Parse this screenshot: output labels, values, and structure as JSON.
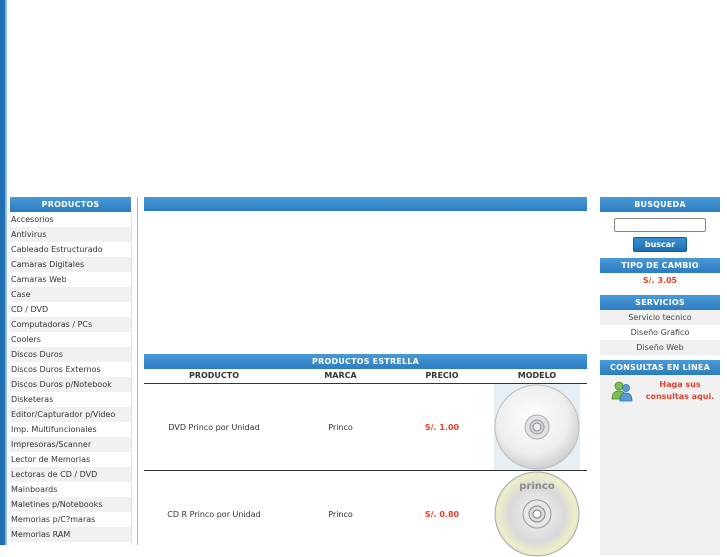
{
  "productos_title": "PRODUCTOS",
  "productos": [
    "Accesorios",
    "Antivirus",
    "Cableado Estructurado",
    "Camaras Digitales",
    "Camaras Web",
    "Case",
    "CD / DVD",
    "Computadoras / PCs",
    "Coolers",
    "Discos Duros",
    "Discos Duros Externos",
    "Discos Duros p/Notebook",
    "Disketeras",
    "Editor/Capturador p/Video",
    "Imp. Multifuncionales",
    "Impresoras/Scanner",
    "Lector de Memorias",
    "Lectoras de CD / DVD",
    "Mainboards",
    "Maletines p/Notebooks",
    "Memorias p/C?maras",
    "Memorias RAM"
  ],
  "estrella": {
    "title": "PRODUCTOS ESTRELLA",
    "headers": {
      "producto": "PRODUCTO",
      "marca": "MARCA",
      "precio": "PRECIO",
      "modelo": "MODELO"
    },
    "rows": [
      {
        "producto": "DVD Princo por Unidad",
        "marca": "Princo",
        "precio": "S/. 1.00"
      },
      {
        "producto": "CD R Princo por Unidad",
        "marca": "Princo",
        "precio": "S/. 0.80"
      }
    ],
    "disc2_brand": "princo"
  },
  "busqueda": {
    "title": "BUSQUEDA",
    "button": "buscar"
  },
  "cambio": {
    "title": "TIPO DE CAMBIO",
    "rate": "S/. 3.05"
  },
  "servicios": {
    "title": "SERVICIOS",
    "items": [
      "Servicio tecnico",
      "Diseño Grafico",
      "Diseño Web"
    ]
  },
  "consultas": {
    "title": "CONSULTAS EN LINEA",
    "link": "Haga sus consultas aqui."
  },
  "colors": {
    "accent": "#2c7cc0",
    "price": "#e4412a"
  }
}
